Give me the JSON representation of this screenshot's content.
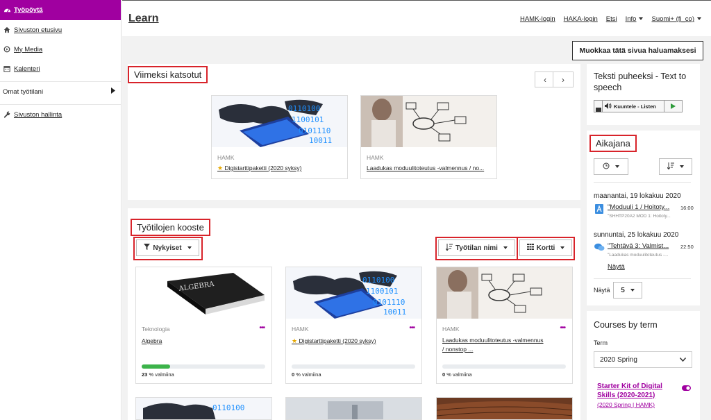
{
  "sidebar": {
    "items": [
      {
        "label": "Työpöytä",
        "icon": "dashboard-icon"
      },
      {
        "label": "Sivuston etusivu",
        "icon": "home-icon"
      },
      {
        "label": "My Media",
        "icon": "media-icon"
      },
      {
        "label": "Kalenteri",
        "icon": "calendar-icon"
      },
      {
        "label": "Omat työtilani",
        "icon": "chevron-right-icon"
      },
      {
        "label": "Sivuston hallinta",
        "icon": "wrench-icon"
      }
    ]
  },
  "header": {
    "brand": "Learn",
    "links": [
      "HAMK-login",
      "HAKA-login",
      "Etsi",
      "Info",
      "Suomi+ (fi_co)"
    ]
  },
  "edit_button": "Muokkaa tätä sivua haluamaksesi",
  "recent": {
    "title": "Viimeksi katsotut",
    "cards": [
      {
        "category": "HAMK",
        "name": "Digistarttipaketti (2020 syksy)",
        "starred": true
      },
      {
        "category": "HAMK",
        "name": "Laadukas moduulitoteutus -valmennus / no...",
        "starred": false
      }
    ]
  },
  "overview": {
    "title": "Työtilojen kooste",
    "filter": "Nykyiset",
    "sort": "Työtilan nimi",
    "view": "Kortti",
    "cards": [
      {
        "category": "Teknologia",
        "name": "Algebra",
        "starred": false,
        "progress": 23,
        "progress_label": "% valmiina"
      },
      {
        "category": "HAMK",
        "name": "Digistarttipaketti (2020 syksy)",
        "starred": true,
        "progress": 0,
        "progress_label": "% valmiina"
      },
      {
        "category": "HAMK",
        "name_line1": "Laadukas moduulitoteutus -valmennus",
        "name_line2": "/ nonstop ...",
        "starred": false,
        "progress": 0,
        "progress_label": "% valmiina"
      }
    ]
  },
  "tts": {
    "title": "Teksti puheeksi - Text to speech",
    "button": "Kuuntele - Listen"
  },
  "timeline": {
    "title": "Aikajana",
    "events": [
      {
        "date": "maanantai, 19 lokakuu 2020",
        "name": "\"Moduuli 1 / Hoitoty...",
        "course": "\"SHHTP20A2 MOD 1: Hoitoty...",
        "time": "16:00",
        "icon": "assignment-icon"
      },
      {
        "date": "sunnuntai, 25 lokakuu 2020",
        "name": "\"Tehtävä 3: Valmist...",
        "course": "\"Laadukas moduulitoteutus -...",
        "time": "22:50",
        "icon": "forum-icon"
      }
    ],
    "show_more": "Näytä",
    "show_label": "Näytä",
    "show_count": "5"
  },
  "courses_by_term": {
    "title": "Courses by term",
    "term_label": "Term",
    "term_value": "2020 Spring",
    "course_line1": "Starter Kit of Digital",
    "course_line2": "Skills (2020-2021)",
    "course_term": "(2020 Spring | HAMK)"
  },
  "colors": {
    "accent": "#a000a0",
    "highlight": "#d8232a",
    "progress": "#3cb34a"
  }
}
